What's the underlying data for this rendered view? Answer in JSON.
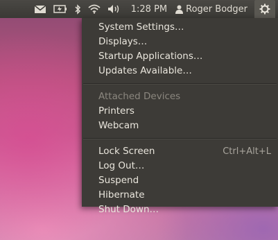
{
  "topbar": {
    "indicators": [
      "mail-icon",
      "battery-icon",
      "bluetooth-icon",
      "wifi-icon",
      "volume-icon"
    ],
    "clock": "1:28 PM",
    "user_name": "Roger Bodger",
    "session_icon": "gear-icon"
  },
  "menu": {
    "system_settings": "System Settings…",
    "displays": "Displays…",
    "startup_applications": "Startup Applications…",
    "updates_available": "Updates Available…",
    "attached_devices_header": "Attached Devices",
    "printers": "Printers",
    "webcam": "Webcam",
    "lock_screen": "Lock Screen",
    "lock_screen_shortcut": "Ctrl+Alt+L",
    "log_out": "Log Out…",
    "suspend": "Suspend",
    "hibernate": "Hibernate",
    "shut_down": "Shut Down…"
  },
  "colors": {
    "panel": "#3c3b37",
    "menu_bg": "#3d3b37",
    "menu_text": "#eae6dd",
    "disabled_text": "#8b877f"
  }
}
